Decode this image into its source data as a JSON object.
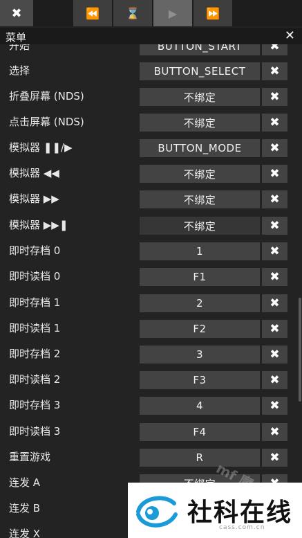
{
  "toolbar": {
    "close_icon": "✖",
    "rewind_icon": "⏪",
    "hourglass_icon": "⌛",
    "play_icon": "▶",
    "fastforward_icon": "⏩"
  },
  "menu": {
    "title": "菜单",
    "close_icon": "✕"
  },
  "clear_icon": "✖",
  "bindings": [
    {
      "label": "开始",
      "value": "BUTTON_START"
    },
    {
      "label": "选择",
      "value": "BUTTON_SELECT"
    },
    {
      "label": "折叠屏幕 (NDS)",
      "value": "不绑定"
    },
    {
      "label": "点击屏幕 (NDS)",
      "value": "不绑定"
    },
    {
      "label": "模拟器 ❚❚/▶",
      "value": "BUTTON_MODE"
    },
    {
      "label": "模拟器 ◀◀",
      "value": "不绑定"
    },
    {
      "label": "模拟器 ▶▶",
      "value": "不绑定"
    },
    {
      "label": "模拟器 ▶▶❚",
      "value": "不绑定"
    },
    {
      "label": "即时存档 0",
      "value": "1"
    },
    {
      "label": "即时读档 0",
      "value": "F1"
    },
    {
      "label": "即时存档 1",
      "value": "2"
    },
    {
      "label": "即时读档 1",
      "value": "F2"
    },
    {
      "label": "即时存档 2",
      "value": "3"
    },
    {
      "label": "即时读档 2",
      "value": "F3"
    },
    {
      "label": "即时存档 3",
      "value": "4"
    },
    {
      "label": "即时读档 3",
      "value": "F4"
    },
    {
      "label": "重置游戏",
      "value": "R"
    },
    {
      "label": "连发 A",
      "value": "不绑定"
    },
    {
      "label": "连发 B",
      "value": ""
    },
    {
      "label": "连发 X",
      "value": ""
    }
  ],
  "watermark": {
    "text": "mf 魔",
    "logo_name": "社科在线",
    "logo_url": "cass.com.cn"
  }
}
